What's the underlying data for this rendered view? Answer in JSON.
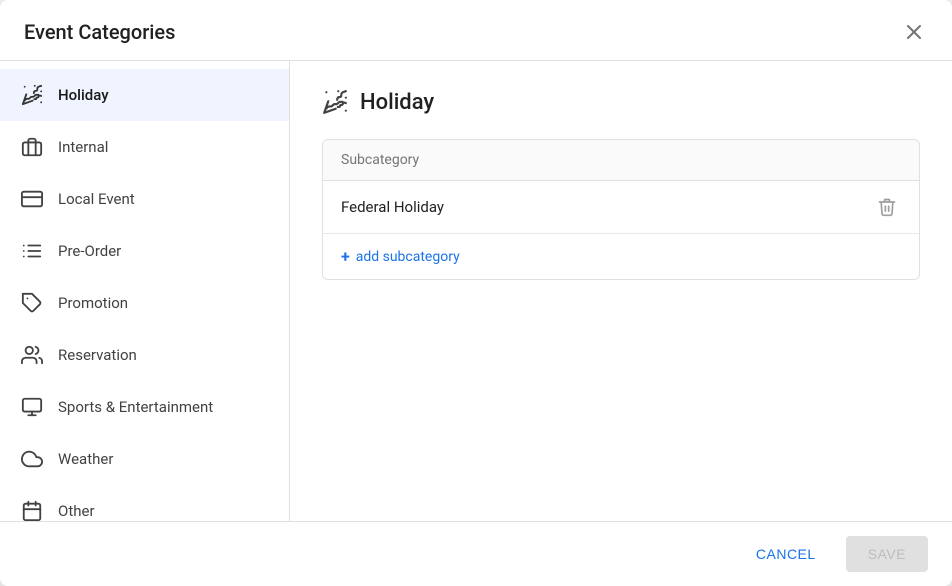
{
  "dialog": {
    "title": "Event Categories",
    "close_label": "×"
  },
  "sidebar": {
    "items": [
      {
        "id": "holiday",
        "label": "Holiday",
        "icon": "party-icon",
        "active": true
      },
      {
        "id": "internal",
        "label": "Internal",
        "icon": "internal-icon",
        "active": false
      },
      {
        "id": "local-event",
        "label": "Local Event",
        "icon": "local-event-icon",
        "active": false
      },
      {
        "id": "pre-order",
        "label": "Pre-Order",
        "icon": "pre-order-icon",
        "active": false
      },
      {
        "id": "promotion",
        "label": "Promotion",
        "icon": "promotion-icon",
        "active": false
      },
      {
        "id": "reservation",
        "label": "Reservation",
        "icon": "reservation-icon",
        "active": false
      },
      {
        "id": "sports-entertainment",
        "label": "Sports & Entertainment",
        "icon": "sports-icon",
        "active": false
      },
      {
        "id": "weather",
        "label": "Weather",
        "icon": "weather-icon",
        "active": false
      },
      {
        "id": "other",
        "label": "Other",
        "icon": "other-icon",
        "active": false
      }
    ]
  },
  "main": {
    "panel_title": "Holiday",
    "subcategory_label": "Subcategory",
    "subcategories": [
      {
        "name": "Federal Holiday"
      }
    ],
    "add_label": "add subcategory"
  },
  "footer": {
    "cancel_label": "CANCEL",
    "save_label": "SAVE"
  }
}
